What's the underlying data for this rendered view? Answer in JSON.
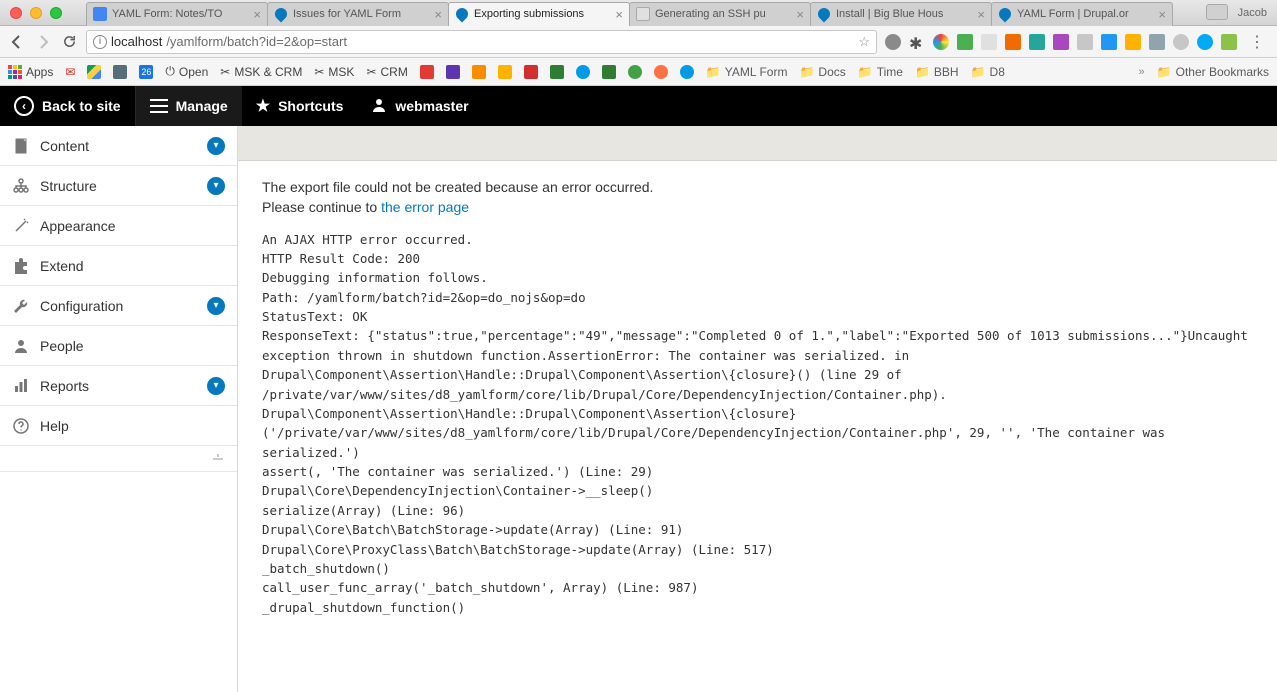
{
  "browser": {
    "profile": "Jacob",
    "tabs": [
      {
        "label": "YAML Form: Notes/TO",
        "favicon": "gdoc",
        "active": false
      },
      {
        "label": "Issues for YAML Form",
        "favicon": "drupal",
        "active": false
      },
      {
        "label": "Exporting submissions",
        "favicon": "drupal",
        "active": true
      },
      {
        "label": "Generating an SSH pu",
        "favicon": "page",
        "active": false
      },
      {
        "label": "Install | Big Blue Hous",
        "favicon": "drupal",
        "active": false
      },
      {
        "label": "YAML Form | Drupal.or",
        "favicon": "drupal",
        "active": false
      }
    ],
    "url_host": "localhost",
    "url_path": "/yamlform/batch?id=2&op=start",
    "bookmarks_left": [
      {
        "label": "Apps",
        "icon": "apps"
      },
      {
        "label": "",
        "icon": "gmail"
      },
      {
        "label": "",
        "icon": "gdrive"
      },
      {
        "label": "",
        "icon": "ptb"
      },
      {
        "label": "26",
        "icon": "cal"
      },
      {
        "label": "Open",
        "icon": "power"
      },
      {
        "label": "MSK & CRM",
        "icon": "scissors"
      },
      {
        "label": "MSK",
        "icon": "scissors"
      },
      {
        "label": "CRM",
        "icon": "scissors"
      }
    ],
    "bookmarks_folders": [
      "YAML Form",
      "Docs",
      "Time",
      "BBH",
      "D8"
    ],
    "other_bookmarks": "Other Bookmarks"
  },
  "toolbar": {
    "back": "Back to site",
    "manage": "Manage",
    "shortcuts": "Shortcuts",
    "user": "webmaster"
  },
  "sidebar": [
    {
      "label": "Content",
      "icon": "doc",
      "expandable": true
    },
    {
      "label": "Structure",
      "icon": "tree",
      "expandable": true
    },
    {
      "label": "Appearance",
      "icon": "wand",
      "expandable": false
    },
    {
      "label": "Extend",
      "icon": "puzzle",
      "expandable": false
    },
    {
      "label": "Configuration",
      "icon": "wrench",
      "expandable": true
    },
    {
      "label": "People",
      "icon": "person",
      "expandable": false
    },
    {
      "label": "Reports",
      "icon": "bars",
      "expandable": true
    },
    {
      "label": "Help",
      "icon": "help",
      "expandable": false
    }
  ],
  "error": {
    "line1": "The export file could not be created because an error occurred.",
    "line2_prefix": "Please continue to ",
    "line2_link": "the error page",
    "debug": "An AJAX HTTP error occurred.\nHTTP Result Code: 200\nDebugging information follows.\nPath: /yamlform/batch?id=2&op=do_nojs&op=do\nStatusText: OK\nResponseText: {\"status\":true,\"percentage\":\"49\",\"message\":\"Completed 0 of 1.\",\"label\":\"Exported 500 of 1013 submissions...\"}Uncaught exception thrown in shutdown function.AssertionError: The container was serialized. in Drupal\\Component\\Assertion\\Handle::Drupal\\Component\\Assertion\\{closure}() (line 29 of /private/var/www/sites/d8_yamlform/core/lib/Drupal/Core/DependencyInjection/Container.php).\nDrupal\\Component\\Assertion\\Handle::Drupal\\Component\\Assertion\\{closure} ('/private/var/www/sites/d8_yamlform/core/lib/Drupal/Core/DependencyInjection/Container.php', 29, '', 'The container was serialized.')\nassert(, 'The container was serialized.') (Line: 29)\nDrupal\\Core\\DependencyInjection\\Container->__sleep()\nserialize(Array) (Line: 96)\nDrupal\\Core\\Batch\\BatchStorage->update(Array) (Line: 91)\nDrupal\\Core\\ProxyClass\\Batch\\BatchStorage->update(Array) (Line: 517)\n_batch_shutdown()\ncall_user_func_array('_batch_shutdown', Array) (Line: 987)\n_drupal_shutdown_function()"
  }
}
